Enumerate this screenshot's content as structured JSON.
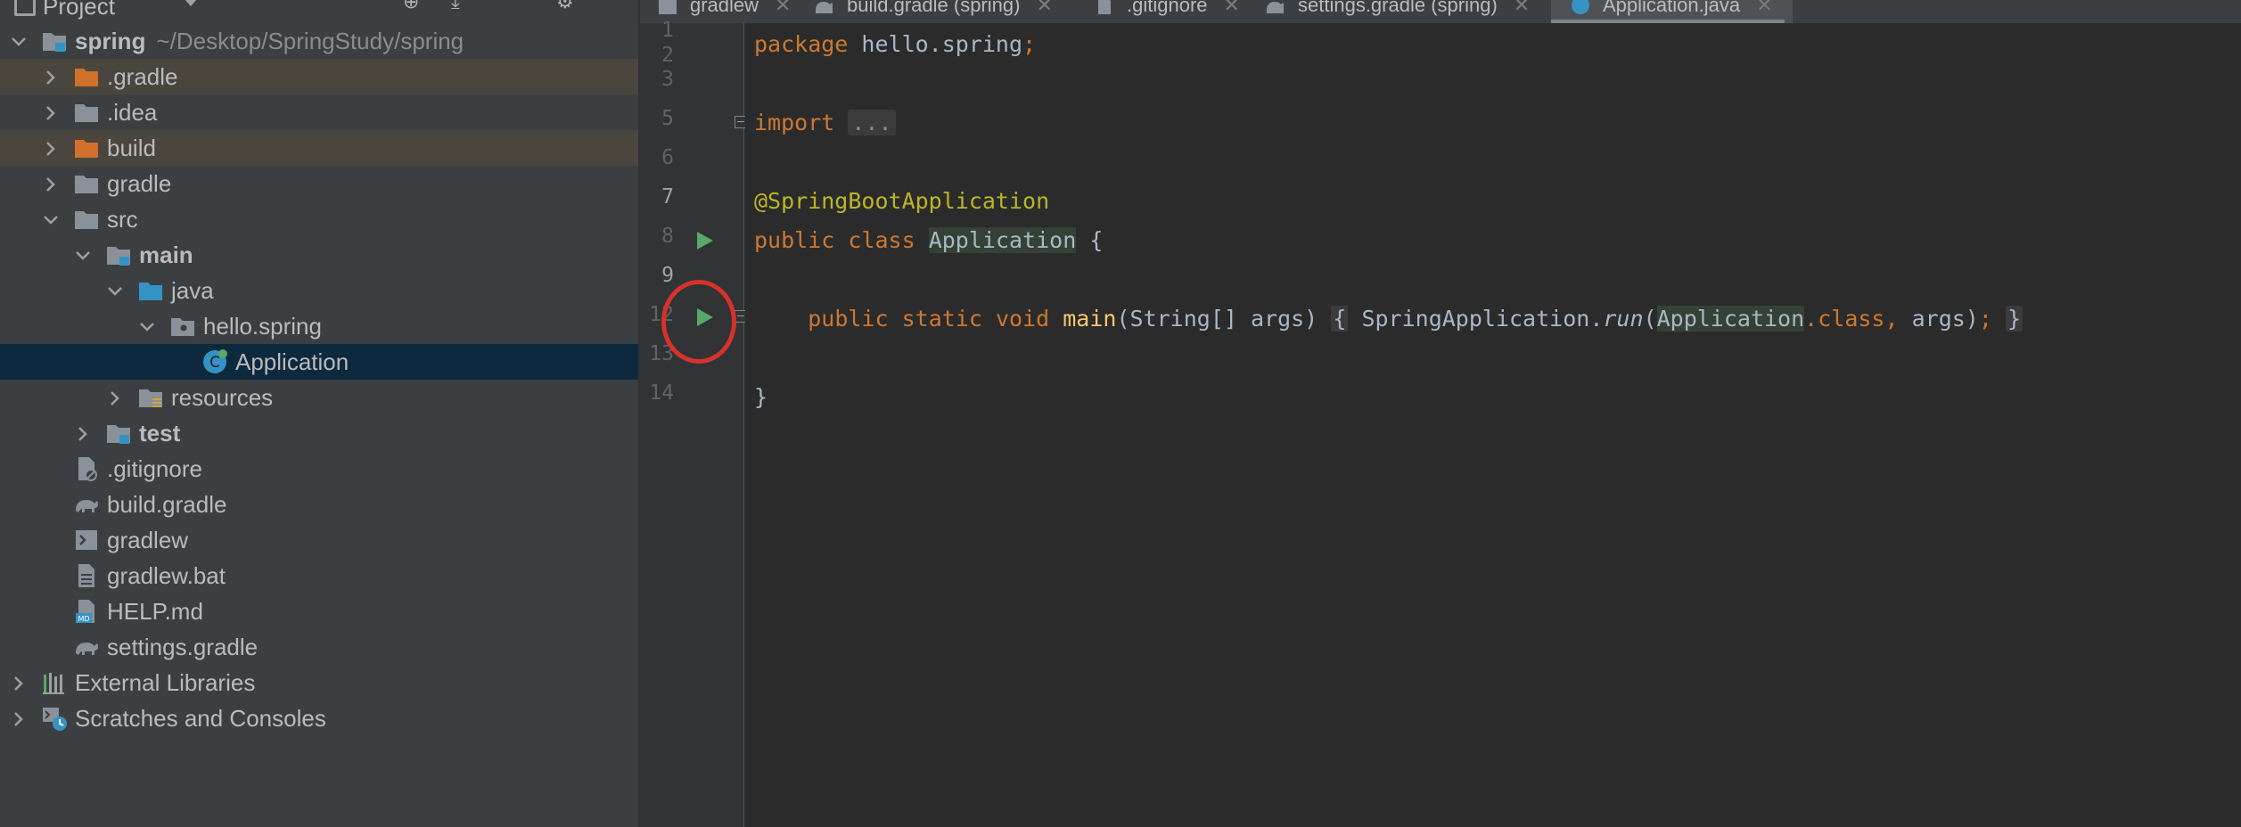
{
  "project_panel": {
    "title": "Project",
    "tree": [
      {
        "label": "spring",
        "path": "~/Desktop/SpringStudy/spring",
        "icon": "module-folder-icon",
        "bold": true,
        "expanded": true
      },
      {
        "label": ".gradle",
        "icon": "folder-orange-icon",
        "highlight": "orange"
      },
      {
        "label": ".idea",
        "icon": "folder-icon"
      },
      {
        "label": "build",
        "icon": "folder-orange-icon",
        "highlight": "orange"
      },
      {
        "label": "gradle",
        "icon": "folder-icon"
      },
      {
        "label": "src",
        "icon": "folder-icon",
        "expanded": true
      },
      {
        "label": "main",
        "icon": "source-folder-icon",
        "bold": true,
        "expanded": true
      },
      {
        "label": "java",
        "icon": "java-source-folder-icon",
        "expanded": true
      },
      {
        "label": "hello.spring",
        "icon": "package-icon",
        "expanded": true
      },
      {
        "label": "Application",
        "icon": "spring-class-icon",
        "selected": true
      },
      {
        "label": "resources",
        "icon": "resources-folder-icon"
      },
      {
        "label": "test",
        "icon": "test-folder-icon",
        "bold": true
      },
      {
        "label": ".gitignore",
        "icon": "gitignore-file-icon"
      },
      {
        "label": "build.gradle",
        "icon": "gradle-file-icon"
      },
      {
        "label": "gradlew",
        "icon": "shell-script-icon"
      },
      {
        "label": "gradlew.bat",
        "icon": "batch-file-icon"
      },
      {
        "label": "HELP.md",
        "icon": "markdown-file-icon"
      },
      {
        "label": "settings.gradle",
        "icon": "gradle-file-icon"
      },
      {
        "label": "External Libraries",
        "icon": "libraries-icon"
      },
      {
        "label": "Scratches and Consoles",
        "icon": "scratches-icon"
      }
    ]
  },
  "tabs": [
    {
      "label": "gradlew",
      "icon": "shell-script-icon"
    },
    {
      "label": "build.gradle (spring)",
      "icon": "gradle-file-icon"
    },
    {
      "label": ".gitignore",
      "icon": "gitignore-file-icon"
    },
    {
      "label": "settings.gradle (spring)",
      "icon": "gradle-file-icon"
    },
    {
      "label": "Application.java",
      "icon": "spring-class-icon",
      "active": true
    }
  ],
  "gutter": {
    "line_numbers": [
      "1",
      "2",
      "3",
      "5",
      "6",
      "7",
      "8",
      "9",
      "12",
      "13",
      "14"
    ]
  },
  "code": {
    "line1": {
      "kw": "package",
      "pkg": "hello.spring",
      "semi": ";"
    },
    "line3": {
      "kw": "import",
      "folded": "..."
    },
    "line6": {
      "annotation": "@SpringBootApplication"
    },
    "line7": {
      "kw_public": "public",
      "kw_class": "class",
      "cls": "Application",
      "brace": "{"
    },
    "line9": {
      "kw_public": "public",
      "kw_static": "static",
      "kw_void": "void",
      "method": "main",
      "params": "(String[] args)",
      "open": "{",
      "call_cls": "SpringApplication",
      "dot": ".",
      "call_method": "run",
      "paren_open": "(",
      "arg_cls": "Application",
      "dot_class": ".class,",
      "args": "args)",
      "semi": ";",
      "close": "}"
    },
    "line13": {
      "brace": "}"
    }
  },
  "colors": {
    "keyword": "#cc7832",
    "annotation": "#bbb529",
    "method": "#ffc66d",
    "text": "#a9b7c6",
    "run_icon": "#59a869",
    "annotation_circle": "#d6322a"
  }
}
